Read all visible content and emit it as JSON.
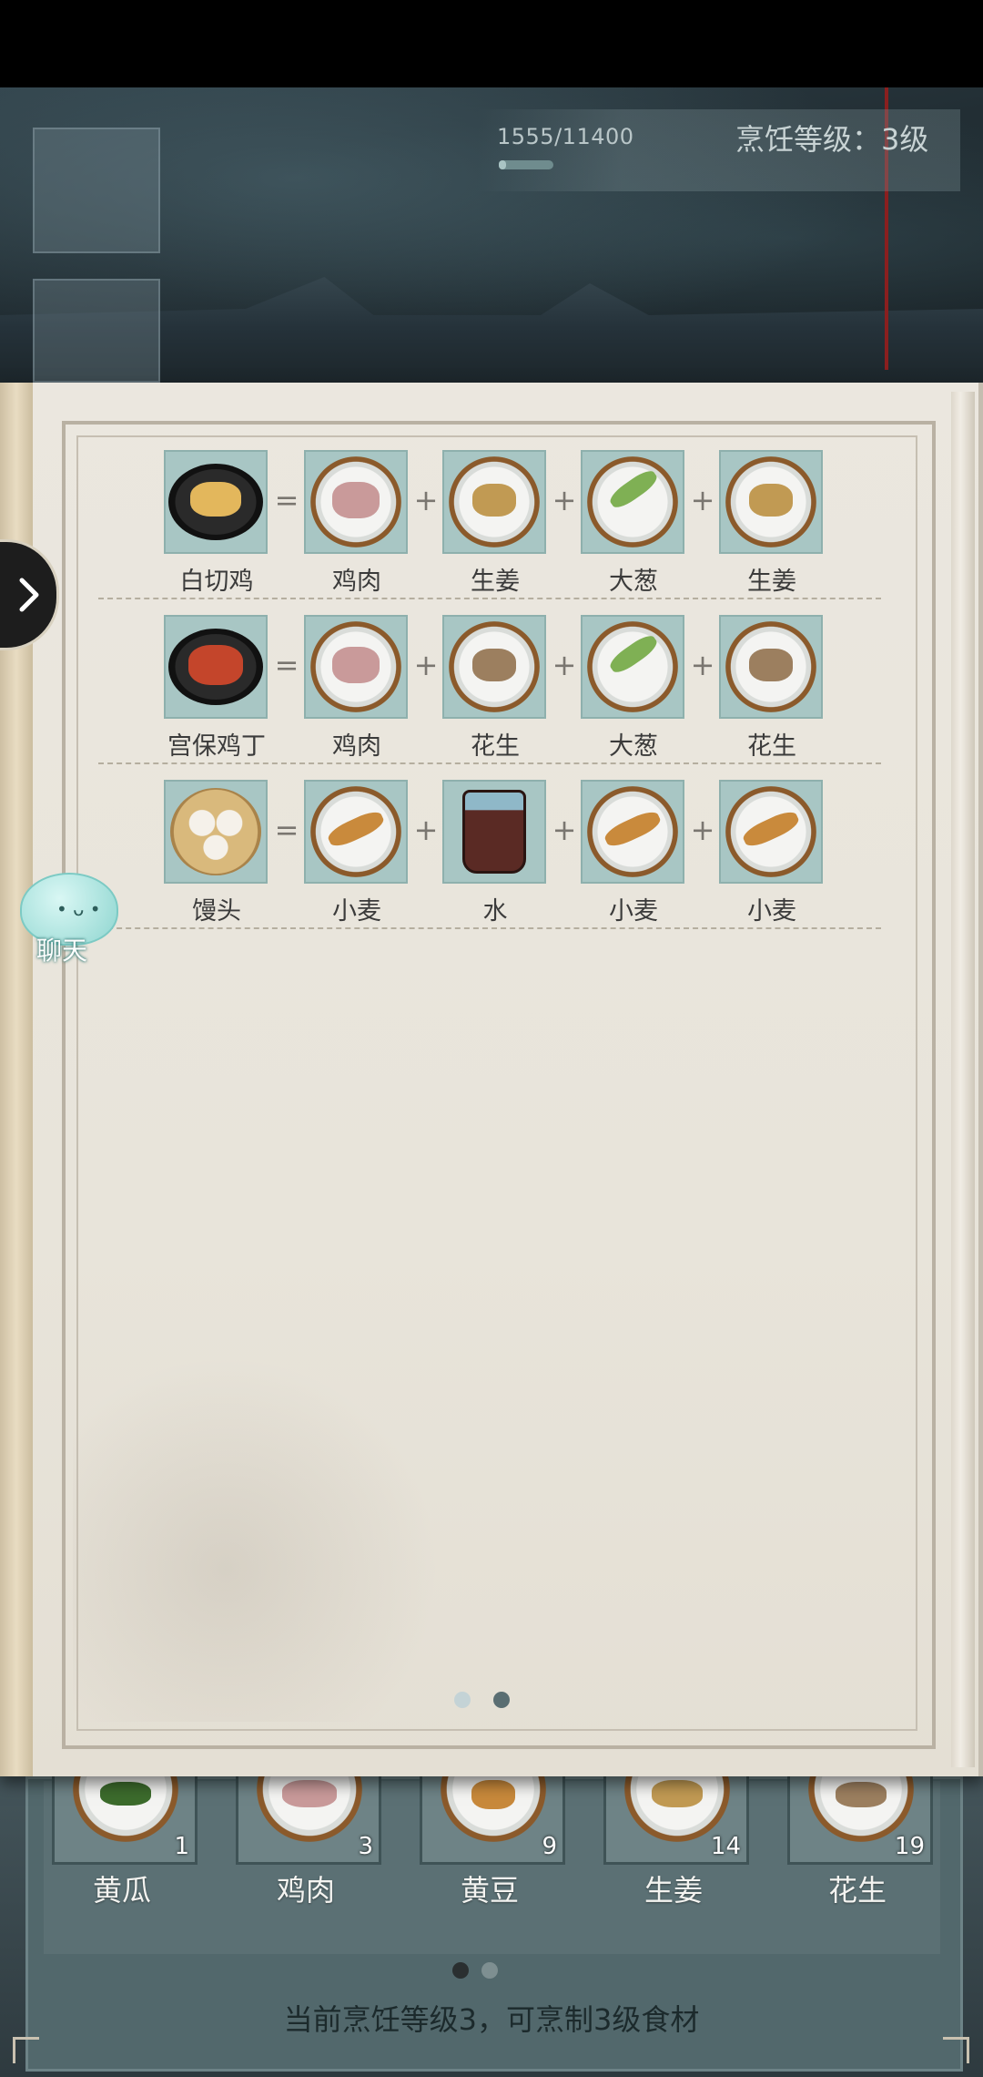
{
  "hud": {
    "xp_current": "1555",
    "xp_max": "11400",
    "xp_progress": 0.136,
    "level_text": "烹饪等级：3级"
  },
  "symbols": {
    "equals": "=",
    "plus": "+"
  },
  "recipes": [
    {
      "dish": "白切鸡",
      "ingredients": [
        "鸡肉",
        "生姜",
        "大葱",
        "生姜"
      ]
    },
    {
      "dish": "宫保鸡丁",
      "ingredients": [
        "鸡肉",
        "花生",
        "大葱",
        "花生"
      ]
    },
    {
      "dish": "馒头",
      "ingredients": [
        "小麦",
        "水",
        "小麦",
        "小麦"
      ]
    }
  ],
  "book_pages": {
    "current": 2,
    "total": 2
  },
  "chat": {
    "label": "聊天"
  },
  "inventory": {
    "items": [
      {
        "name": "黄瓜",
        "count": "1"
      },
      {
        "name": "鸡肉",
        "count": "3"
      },
      {
        "name": "黄豆",
        "count": "9"
      },
      {
        "name": "生姜",
        "count": "14"
      },
      {
        "name": "花生",
        "count": "19"
      }
    ],
    "page": {
      "current": 1,
      "total": 2
    },
    "note": "当前烹饪等级3，可烹制3级食材"
  },
  "colors": {
    "slot_bg": "#a8c6c4",
    "page_bg": "#ebe7df",
    "panel_bg": "#52686c",
    "xp_fill": "#a9c4c4"
  }
}
